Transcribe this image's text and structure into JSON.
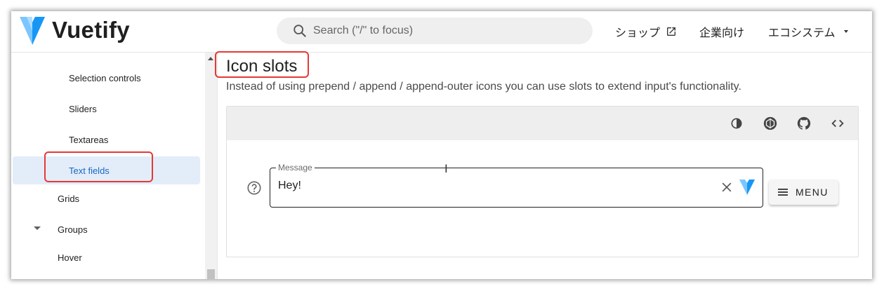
{
  "header": {
    "logo_text": "Vuetify",
    "search_placeholder": "Search (\"/\" to focus)",
    "nav": [
      {
        "label": "ショップ",
        "icon": "open-in-new-icon"
      },
      {
        "label": "企業向け"
      },
      {
        "label": "エコシステム",
        "icon": "caret-down-icon"
      }
    ]
  },
  "sidebar": {
    "items": [
      {
        "label": "Selection controls"
      },
      {
        "label": "Sliders"
      },
      {
        "label": "Textareas"
      },
      {
        "label": "Text fields",
        "active": true
      },
      {
        "label": "Grids"
      },
      {
        "label": "Groups",
        "expandable": true
      },
      {
        "label": "Hover"
      }
    ]
  },
  "main": {
    "title": "Icon slots",
    "description": "Instead of using prepend / append / append-outer icons you can use slots to extend input's functionality.",
    "example": {
      "toolbar_icons": [
        "invert-colors-icon",
        "codepen-icon",
        "github-icon",
        "code-icon"
      ],
      "field_label": "Message",
      "field_value": "Hey!",
      "menu_button_label": "MENU"
    }
  },
  "colors": {
    "accent": "#1867c0",
    "active_bg": "#e3edf9",
    "highlight": "#e53935",
    "vuetify_light": "#7bc6ff",
    "vuetify_dark": "#1697f6"
  }
}
